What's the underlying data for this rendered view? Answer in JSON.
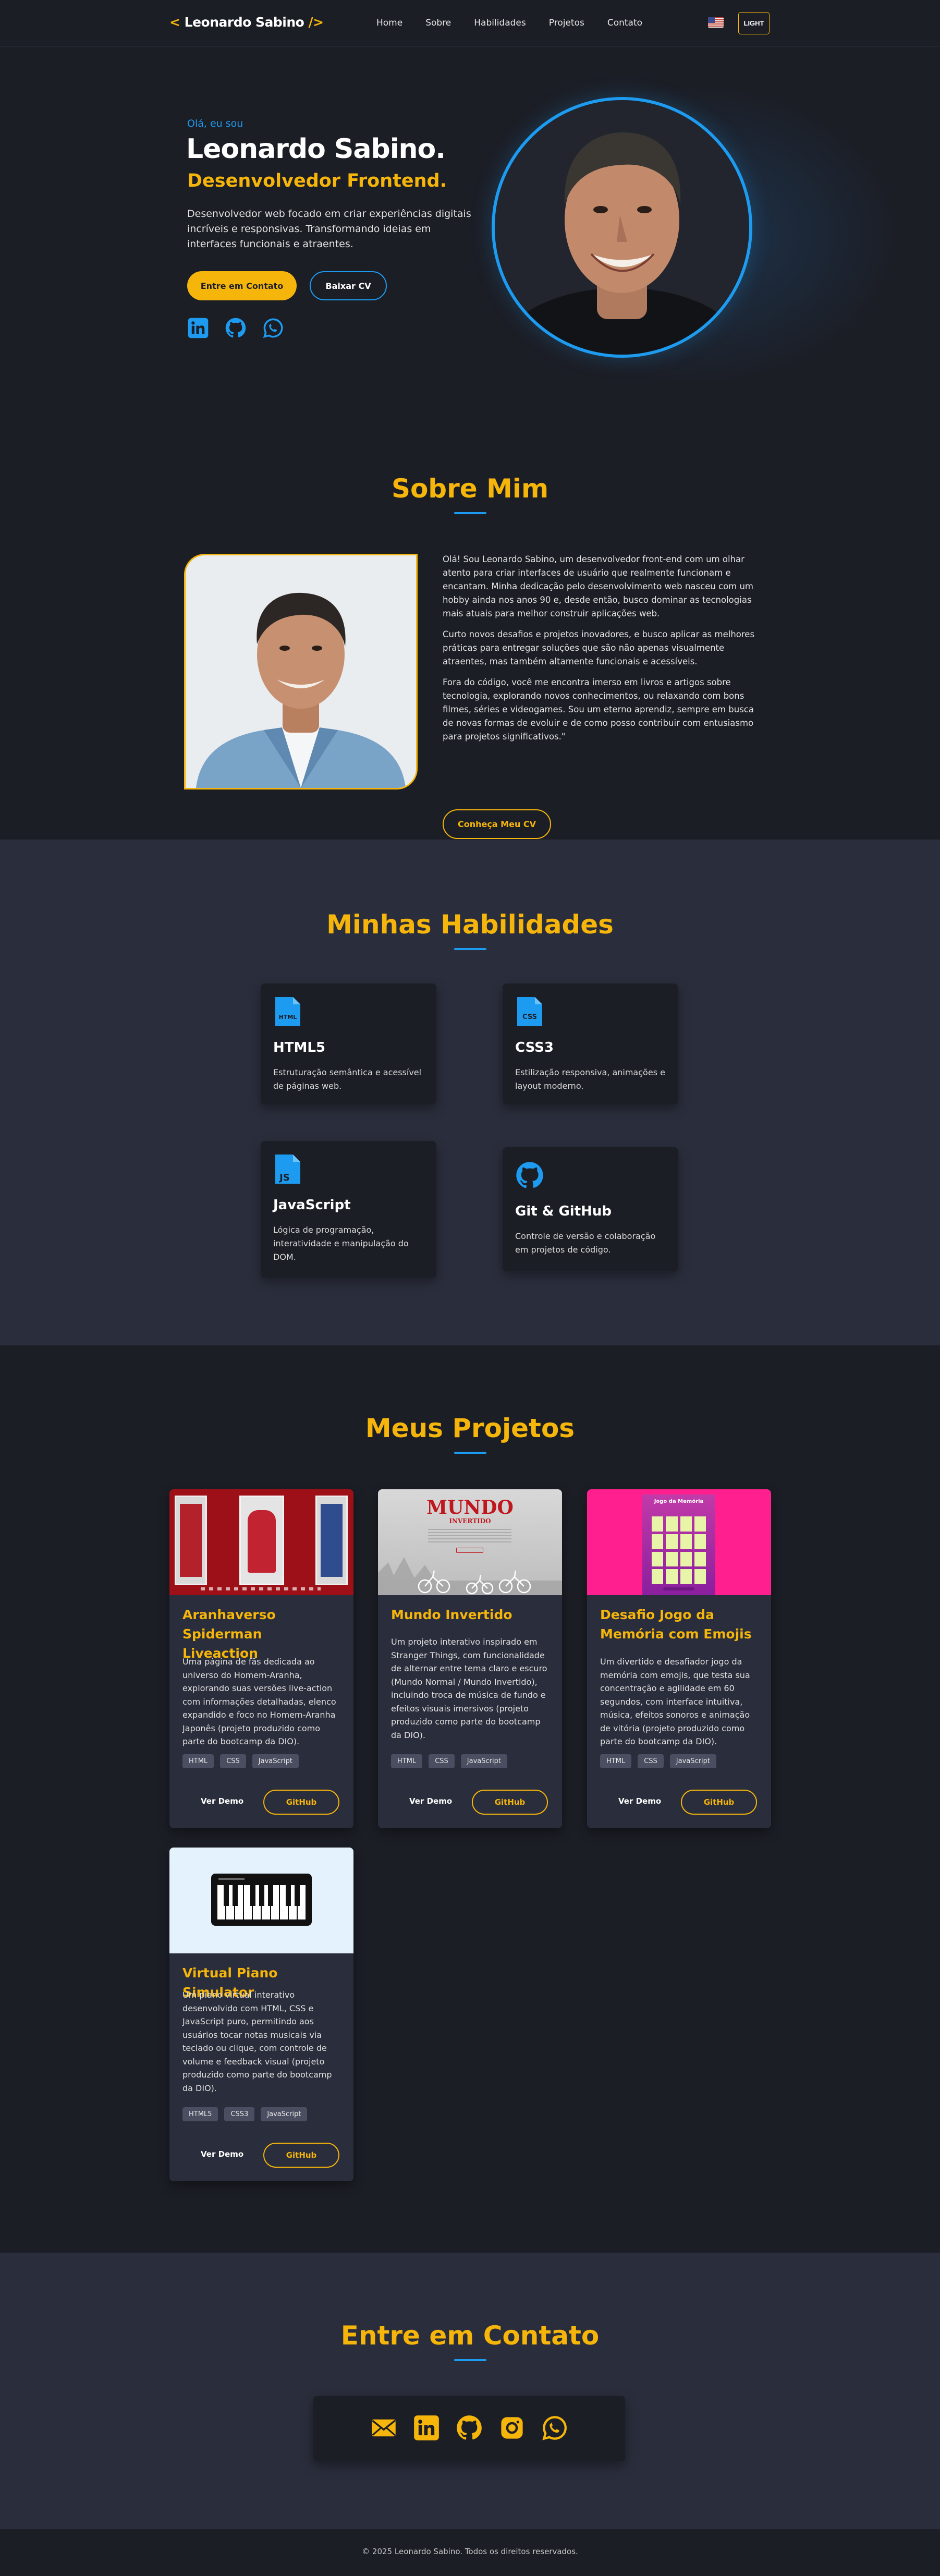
{
  "nav": {
    "logo_open": "<",
    "logo_name": "Leonardo Sabino",
    "logo_close": "/>",
    "links": [
      "Home",
      "Sobre",
      "Habilidades",
      "Projetos",
      "Contato"
    ],
    "theme_toggle": "LIGHT",
    "flag_icon": "us-flag-icon"
  },
  "hero": {
    "greeting": "Olá, eu sou",
    "name": "Leonardo Sabino.",
    "role": "Desenvolvedor Frontend.",
    "description": "Desenvolvedor web focado em criar experiências digitais incríveis e responsivas. Transformando ideias em interfaces funcionais e atraentes.",
    "primary_button": "Entre em Contato",
    "secondary_button": "Baixar CV",
    "socials": [
      "linkedin-icon",
      "github-icon",
      "whatsapp-icon"
    ]
  },
  "about": {
    "title": "Sobre Mim",
    "paragraphs": [
      "Olá! Sou Leonardo Sabino, um desenvolvedor front-end com um olhar atento para criar interfaces de usuário que realmente funcionam e encantam. Minha dedicação pelo desenvolvimento web nasceu com um hobby ainda nos anos 90 e, desde então, busco dominar as tecnologias mais atuais para melhor construir aplicações web.",
      "Curto novos desafios e projetos inovadores, e busco aplicar as melhores práticas para entregar soluções que são não apenas visualmente atraentes, mas também altamente funcionais e acessíveis.",
      "Fora do código, você me encontra imerso em livros e artigos sobre tecnologia, explorando novos conhecimentos, ou relaxando com bons filmes, séries e videogames. Sou um eterno aprendiz, sempre em busca de novas formas de evoluir e de como posso contribuir com entusiasmo para projetos significativos.\""
    ],
    "button": "Conheça Meu CV"
  },
  "skills": {
    "title": "Minhas Habilidades",
    "items": [
      {
        "icon": "html5-file-icon",
        "icon_text": "HTML",
        "title": "HTML5",
        "description": "Estruturação semântica e acessível de páginas web."
      },
      {
        "icon": "css3-file-icon",
        "icon_text": "CSS",
        "title": "CSS3",
        "description": "Estilização responsiva, animações e layout moderno."
      },
      {
        "icon": "javascript-file-icon",
        "icon_text": "JS",
        "title": "JavaScript",
        "description": "Lógica de programação, interatividade e manipulação do DOM."
      },
      {
        "icon": "github-icon",
        "icon_text": "",
        "title": "Git & GitHub",
        "description": "Controle de versão e colaboração em projetos de código."
      }
    ]
  },
  "projects": {
    "title": "Meus Projetos",
    "demo_label": "Ver Demo",
    "github_label": "GitHub",
    "items": [
      {
        "title": "Aranhaverso Spiderman Liveaction",
        "description": "Uma página de fãs dedicada ao universo do Homem-Aranha, explorando suas versões live-action com informações detalhadas, elenco expandido e foco no Homem-Aranha Japonês (projeto produzido como parte do bootcamp da DIO).",
        "tags": [
          "HTML",
          "CSS",
          "JavaScript"
        ]
      },
      {
        "title": "Mundo Invertido",
        "description": "Um projeto interativo inspirado em Stranger Things, com funcionalidade de alternar entre tema claro e escuro (Mundo Normal / Mundo Invertido), incluindo troca de música de fundo e efeitos visuais imersivos (projeto produzido como parte do bootcamp da DIO).",
        "tags": [
          "HTML",
          "CSS",
          "JavaScript"
        ],
        "thumb_title": "MUNDO",
        "thumb_sub": "INVERTIDO"
      },
      {
        "title": "Desafio Jogo da Memória com Emojis",
        "description": "Um divertido e desafiador jogo da memória com emojis, que testa sua concentração e agilidade em 60 segundos, com interface intuitiva, música, efeitos sonoros e animação de vitória (projeto produzido como parte do bootcamp da DIO).",
        "tags": [
          "HTML",
          "CSS",
          "JavaScript"
        ],
        "thumb_title": "Jogo da Memória"
      },
      {
        "title": "Virtual Piano Simulator",
        "description": "Um piano virtual interativo desenvolvido com HTML, CSS e JavaScript puro, permitindo aos usuários tocar notas musicais via teclado ou clique, com controle de volume e feedback visual (projeto produzido como parte do bootcamp da DIO).",
        "tags": [
          "HTML5",
          "CSS3",
          "JavaScript"
        ]
      }
    ]
  },
  "contact": {
    "title": "Entre em Contato",
    "icons": [
      "email-icon",
      "linkedin-icon",
      "github-icon",
      "instagram-icon",
      "whatsapp-icon"
    ]
  },
  "footer": {
    "text": "© 2025 Leonardo Sabino. Todos os direitos reservados."
  },
  "colors": {
    "background": "#1c1e26",
    "section_alt": "#2a2d3b",
    "accent_gold": "#f5b50a",
    "accent_blue": "#1d9bf0",
    "pink": "#ff1f8e"
  }
}
